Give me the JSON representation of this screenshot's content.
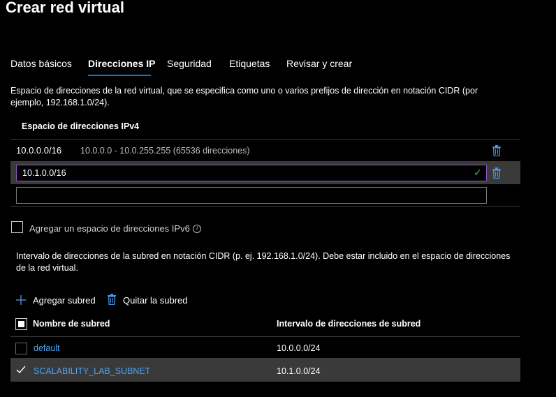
{
  "page": {
    "title": "Crear red virtual"
  },
  "tabs": [
    {
      "label": "Datos básicos",
      "active": false
    },
    {
      "label": "Direcciones IP",
      "active": true
    },
    {
      "label": "Seguridad",
      "active": false
    },
    {
      "label": "Etiquetas",
      "active": false
    },
    {
      "label": "Revisar y crear",
      "active": false
    }
  ],
  "address_space": {
    "description_line1": "Espacio de direcciones de la red virtual, que se especifica como uno o varios prefijos de dirección en notación CIDR (por",
    "description_line2": "ejemplo, 192.168.1.0/24).",
    "header": "Espacio de direcciones IPv4",
    "entries": [
      {
        "cidr": "10.0.0.0/16",
        "range": "10.0.0.0 - 10.0.255.255 (65536 direcciones)"
      }
    ],
    "editing_value": "10.1.0.0/16",
    "empty_value": "",
    "ipv6_label": "Agregar un espacio de direcciones IPv6"
  },
  "subnets": {
    "description_line1": "Intervalo de direcciones de la subred en notación CIDR (p. ej. 192.168.1.0/24). Debe estar incluido en el espacio de direcciones",
    "description_line2": "de la red virtual.",
    "add_label": "Agregar subred",
    "remove_label": "Quitar la subred",
    "columns": [
      "Nombre de subred",
      "Intervalo de direcciones de subred"
    ],
    "rows": [
      {
        "name": "default",
        "range": "10.0.0.0/24",
        "selected": false
      },
      {
        "name": "SCALABILITY_LAB_SUBNET",
        "range": "10.1.0.0/24",
        "selected": true
      }
    ]
  },
  "colors": {
    "accent": "#0078d4",
    "link": "#4aa3f0",
    "focus_border": "#8a57c4",
    "valid": "#4caf50"
  }
}
